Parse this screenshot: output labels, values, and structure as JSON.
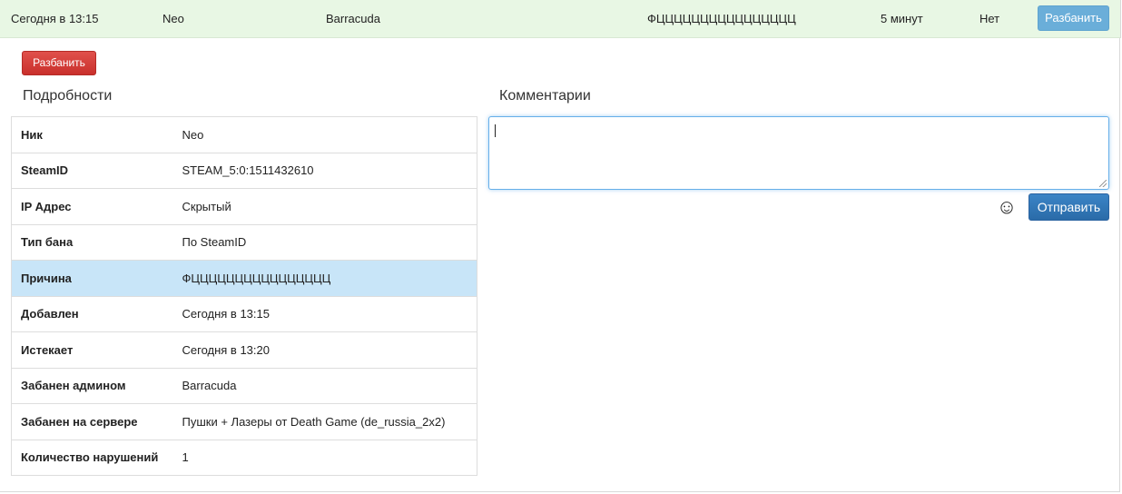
{
  "ban_row": {
    "date": "Сегодня в 13:15",
    "nick": "Neo",
    "admin": "Barracuda",
    "reason": "ФЦЦЦЦЦЦЦЦЦЦЦЦЦЦЦЦ",
    "duration": "5 минут",
    "flag": "Нет",
    "unban_label": "Разбанить"
  },
  "actions": {
    "unban_label": "Разбанить"
  },
  "details": {
    "title": "Подробности",
    "rows": [
      {
        "key": "Ник",
        "value": "Neo"
      },
      {
        "key": "SteamID",
        "value": "STEAM_5:0:1511432610"
      },
      {
        "key": "IP Адрес",
        "value": "Скрытый"
      },
      {
        "key": "Тип бана",
        "value": "По SteamID"
      },
      {
        "key": "Причина",
        "value": "ФЦЦЦЦЦЦЦЦЦЦЦЦЦЦЦЦ"
      },
      {
        "key": "Добавлен",
        "value": "Сегодня в 13:15"
      },
      {
        "key": "Истекает",
        "value": "Сегодня в 13:20"
      },
      {
        "key": "Забанен админом",
        "value": "Barracuda"
      },
      {
        "key": "Забанен на сервере",
        "value": "Пушки + Лазеры от Death Game (de_russia_2x2)"
      },
      {
        "key": "Количество нарушений",
        "value": "1"
      }
    ]
  },
  "comments": {
    "title": "Комментарии",
    "input_value": "",
    "emoji_icon": "smiley-icon",
    "send_label": "Отправить"
  }
}
